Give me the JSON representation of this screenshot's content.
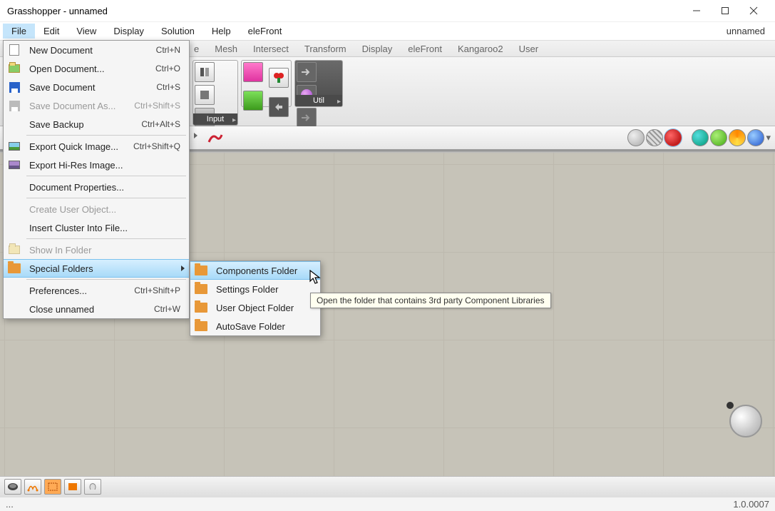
{
  "title": "Grasshopper - unnamed",
  "rlabel": "unnamed",
  "menubar": [
    "File",
    "Edit",
    "View",
    "Display",
    "Solution",
    "Help",
    "eleFront"
  ],
  "tabs": [
    "e",
    "Mesh",
    "Intersect",
    "Transform",
    "Display",
    "eleFront",
    "Kangaroo2",
    "User"
  ],
  "panel1_label": "Input",
  "panel2_label": "Util",
  "filemenu": {
    "items": [
      {
        "t": "New Document",
        "s": "Ctrl+N",
        "ico": "doc"
      },
      {
        "t": "Open Document...",
        "s": "Ctrl+O",
        "ico": "folder-g"
      },
      {
        "t": "Save Document",
        "s": "Ctrl+S",
        "ico": "floppy-b"
      },
      {
        "t": "Save Document As...",
        "s": "Ctrl+Shift+S",
        "ico": "floppy-g",
        "dis": true
      },
      {
        "t": "Save Backup",
        "s": "Ctrl+Alt+S"
      },
      {
        "sep": true
      },
      {
        "t": "Export Quick Image...",
        "s": "Ctrl+Shift+Q",
        "ico": "pic"
      },
      {
        "t": "Export Hi-Res Image...",
        "ico": "pic2"
      },
      {
        "sep": true
      },
      {
        "t": "Document Properties..."
      },
      {
        "sep": true
      },
      {
        "t": "Create User Object...",
        "dis": true
      },
      {
        "t": "Insert Cluster Into File..."
      },
      {
        "sep": true
      },
      {
        "t": "Show In Folder",
        "dis": true,
        "ico": "folder-g"
      },
      {
        "t": "Special Folders",
        "ico": "folder-o",
        "hl": true,
        "sub": true
      },
      {
        "sep": true
      },
      {
        "t": "Preferences...",
        "s": "Ctrl+Shift+P"
      },
      {
        "t": "Close unnamed",
        "s": "Ctrl+W"
      }
    ]
  },
  "submenu": [
    "Components Folder",
    "Settings Folder",
    "User Object Folder",
    "AutoSave Folder"
  ],
  "tooltip": "Open the folder that contains 3rd party Component Libraries",
  "status_left": "...",
  "status_right": "1.0.0007"
}
